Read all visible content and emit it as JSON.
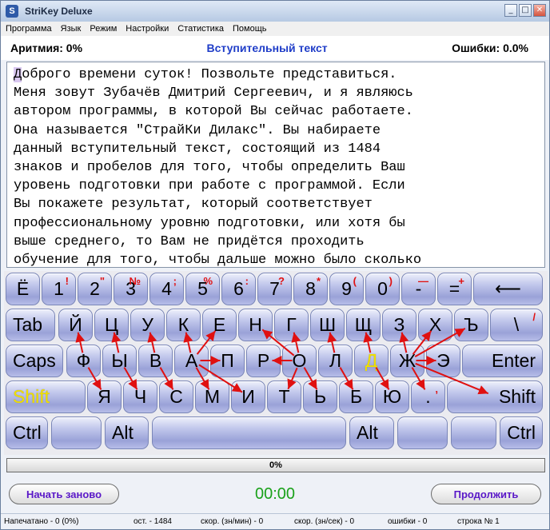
{
  "window": {
    "title": "StriKey Deluxe",
    "controls": {
      "minimize": "_",
      "maximize": "□",
      "close": "✕"
    }
  },
  "menu": [
    "Программа",
    "Язык",
    "Режим",
    "Настройки",
    "Статистика",
    "Помощь"
  ],
  "header": {
    "arrhythmia": "Аритмия: 0%",
    "title": "Вступительный текст",
    "errors": "Ошибки: 0.0%"
  },
  "text": {
    "first_char": "Д",
    "lines": [
      "оброго времени суток! Позвольте представиться.",
      "Меня зовут Зубачёв Дмитрий Сергеевич, и я являюсь",
      "автором программы, в которой Вы сейчас работаете.",
      "Она называется \"СтрайКи Дилакс\". Вы набираете",
      "данный вступительный текст, состоящий из 1484",
      "знаков и пробелов для того, чтобы определить Ваш",
      "уровень подготовки при работе с программой. Если",
      "Вы покажете результат, который соответствует",
      "профессиональному уровню подготовки, или хотя бы",
      "выше среднего, то Вам не придётся проходить",
      "обучение для того, чтобы дальше можно было сколько"
    ]
  },
  "keyboard": {
    "row1": [
      {
        "l": "Ё",
        "s": ""
      },
      {
        "l": "1",
        "s": "!"
      },
      {
        "l": "2",
        "s": "\""
      },
      {
        "l": "3",
        "s": "№"
      },
      {
        "l": "4",
        "s": ";"
      },
      {
        "l": "5",
        "s": "%"
      },
      {
        "l": "6",
        "s": ":"
      },
      {
        "l": "7",
        "s": "?"
      },
      {
        "l": "8",
        "s": "*"
      },
      {
        "l": "9",
        "s": "("
      },
      {
        "l": "0",
        "s": ")"
      },
      {
        "l": "-",
        "s": "—"
      },
      {
        "l": "=",
        "s": "+"
      },
      {
        "l": "⟵",
        "s": ""
      }
    ],
    "row2": [
      {
        "l": "Tab",
        "s": ""
      },
      {
        "l": "Й",
        "s": ""
      },
      {
        "l": "Ц",
        "s": ""
      },
      {
        "l": "У",
        "s": ""
      },
      {
        "l": "К",
        "s": ""
      },
      {
        "l": "Е",
        "s": ""
      },
      {
        "l": "Н",
        "s": ""
      },
      {
        "l": "Г",
        "s": ""
      },
      {
        "l": "Ш",
        "s": ""
      },
      {
        "l": "Щ",
        "s": ""
      },
      {
        "l": "З",
        "s": ""
      },
      {
        "l": "Х",
        "s": ""
      },
      {
        "l": "Ъ",
        "s": ""
      },
      {
        "l": "\\",
        "s": "/"
      }
    ],
    "row3": [
      {
        "l": "Caps",
        "s": ""
      },
      {
        "l": "Ф",
        "s": ""
      },
      {
        "l": "Ы",
        "s": ""
      },
      {
        "l": "В",
        "s": ""
      },
      {
        "l": "А",
        "s": ""
      },
      {
        "l": "П",
        "s": ""
      },
      {
        "l": "Р",
        "s": ""
      },
      {
        "l": "О",
        "s": ""
      },
      {
        "l": "Л",
        "s": ""
      },
      {
        "l": "Д",
        "s": ""
      },
      {
        "l": "Ж",
        "s": ""
      },
      {
        "l": "Э",
        "s": ""
      },
      {
        "l": "Enter",
        "s": ""
      }
    ],
    "row4": [
      {
        "l": "Shift",
        "s": ""
      },
      {
        "l": "Я",
        "s": ""
      },
      {
        "l": "Ч",
        "s": ""
      },
      {
        "l": "С",
        "s": ""
      },
      {
        "l": "М",
        "s": ""
      },
      {
        "l": "И",
        "s": ""
      },
      {
        "l": "Т",
        "s": ""
      },
      {
        "l": "Ь",
        "s": ""
      },
      {
        "l": "Б",
        "s": ""
      },
      {
        "l": "Ю",
        "s": ""
      },
      {
        "l": ".",
        "s": ","
      },
      {
        "l": "Shift",
        "s": ""
      }
    ],
    "row5": [
      {
        "l": "Ctrl",
        "s": ""
      },
      {
        "l": "",
        "s": ""
      },
      {
        "l": "Alt",
        "s": ""
      },
      {
        "l": "",
        "s": ""
      },
      {
        "l": "Alt",
        "s": ""
      },
      {
        "l": "",
        "s": ""
      },
      {
        "l": "",
        "s": ""
      },
      {
        "l": "Ctrl",
        "s": ""
      }
    ],
    "highlight_color": "#f0e000",
    "arrow_color": "#e01010"
  },
  "progress": {
    "label": "0%",
    "value": 0
  },
  "controls": {
    "restart": "Начать заново",
    "timer": "00:00",
    "continue": "Продолжить"
  },
  "statusbar": {
    "typed": "Напечатано - 0 (0%)",
    "remaining": "ост. - 1484",
    "speed_min": "скор. (зн/мин) - 0",
    "speed_sec": "скор. (зн/сек) - 0",
    "errors": "ошибки - 0",
    "line": "строка № 1"
  }
}
